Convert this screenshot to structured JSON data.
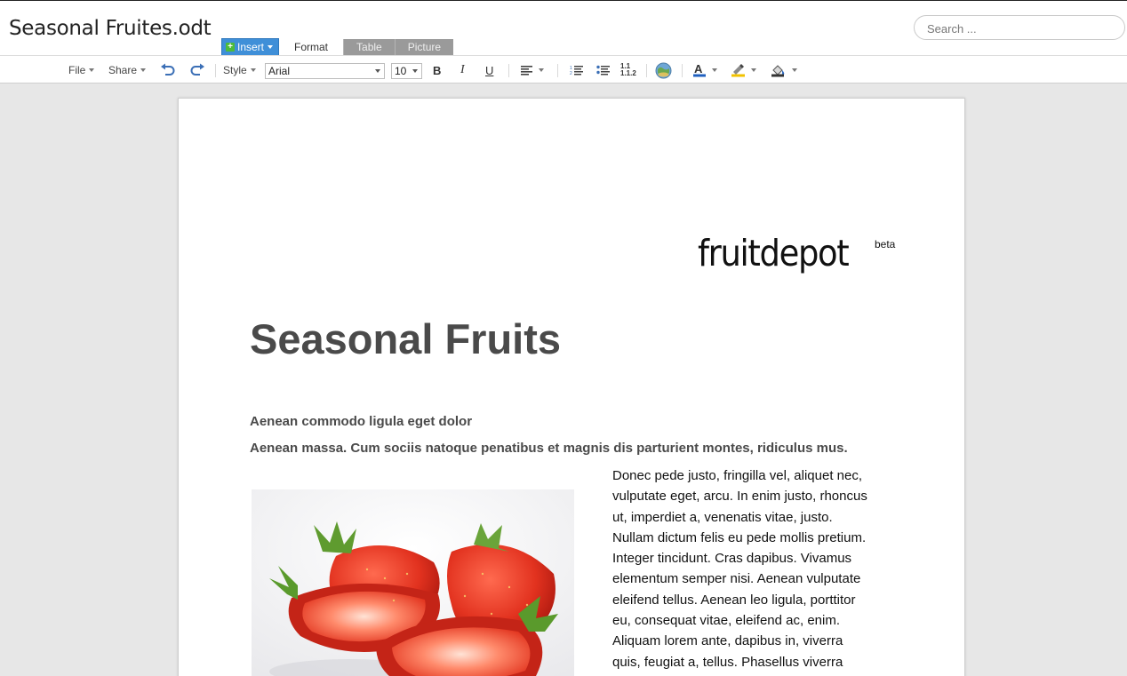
{
  "app": {
    "document_title": "Seasonal Fruites.odt"
  },
  "search": {
    "placeholder": "Search ..."
  },
  "tabs": [
    {
      "label": "Insert"
    },
    {
      "label": "Format"
    },
    {
      "label": "Table"
    },
    {
      "label": "Picture"
    }
  ],
  "toolbar": {
    "file_label": "File",
    "share_label": "Share",
    "style_label": "Style",
    "font_family": "Arial",
    "font_size": "10",
    "bold_label": "B",
    "italic_label": "I",
    "underline_label": "U",
    "numbering_label": "1.1\n1.1.2",
    "icons": [
      "undo-icon",
      "redo-icon",
      "align-left-icon",
      "numbered-list-icon",
      "bullet-list-icon",
      "outline-numbering-icon",
      "insert-link-icon",
      "font-color-icon",
      "highlight-color-icon",
      "background-fill-icon"
    ]
  },
  "document": {
    "logo_text": "fruitdepot",
    "logo_superscript": "beta",
    "heading": "Seasonal Fruits",
    "subheading_1": "Aenean commodo ligula eget dolor",
    "subheading_2": "Aenean massa. Cum sociis natoque penatibus et magnis dis parturient montes, ridiculus mus.",
    "image_subject": "strawberries",
    "body_lines": [
      "Donec pede justo, fringilla vel, aliquet nec,",
      "vulputate eget, arcu. In enim justo, rhoncus",
      "ut, imperdiet a, venenatis vitae, justo.",
      "Nullam dictum felis eu pede mollis pretium.",
      "Integer tincidunt. Cras dapibus. Vivamus",
      "elementum semper nisi. Aenean vulputate",
      "eleifend tellus. Aenean leo ligula, porttitor",
      "eu, consequat vitae, eleifend ac, enim.",
      "Aliquam lorem ante, dapibus in, viverra",
      "quis, feugiat a, tellus. Phasellus viverra"
    ]
  },
  "colors": {
    "insert_tab": "#3f8fd8",
    "inactive_tab": "#9a9a9a",
    "heading_text": "#4a4a4a",
    "workspace_bg": "#e7e7e7"
  }
}
